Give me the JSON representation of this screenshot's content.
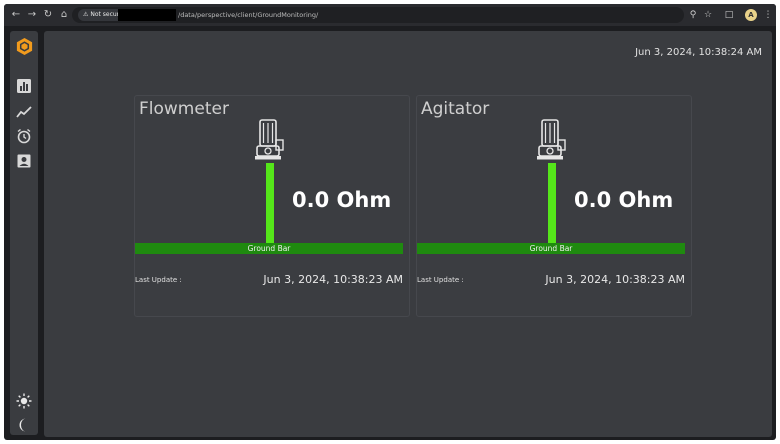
{
  "browser": {
    "security_label": "Not secure",
    "url_path": "/data/perspective/client/GroundMonitoring/",
    "profile_initial": "A"
  },
  "sidebar": {
    "items": [
      {
        "icon": "bar-chart-icon"
      },
      {
        "icon": "line-chart-icon"
      },
      {
        "icon": "alarm-clock-icon"
      },
      {
        "icon": "user-card-icon"
      }
    ],
    "bottom": [
      {
        "icon": "sun-icon"
      },
      {
        "icon": "moon-icon"
      }
    ]
  },
  "main": {
    "timestamp": "Jun 3, 2024, 10:38:24 AM",
    "cards": [
      {
        "title": "Flowmeter",
        "reading": "0.0 Ohm",
        "bar_label": "Ground Bar",
        "last_update_label": "Last Update :",
        "last_update_value": "Jun 3, 2024, 10:38:23 AM"
      },
      {
        "title": "Agitator",
        "reading": "0.0 Ohm",
        "bar_label": "Ground Bar",
        "last_update_label": "Last Update :",
        "last_update_value": "Jun 3, 2024, 10:38:23 AM"
      }
    ]
  },
  "colors": {
    "accent": "#f29b1d",
    "wire": "#55e61a",
    "ground_bar": "#1f8a0f",
    "panel": "#3a3c40"
  }
}
